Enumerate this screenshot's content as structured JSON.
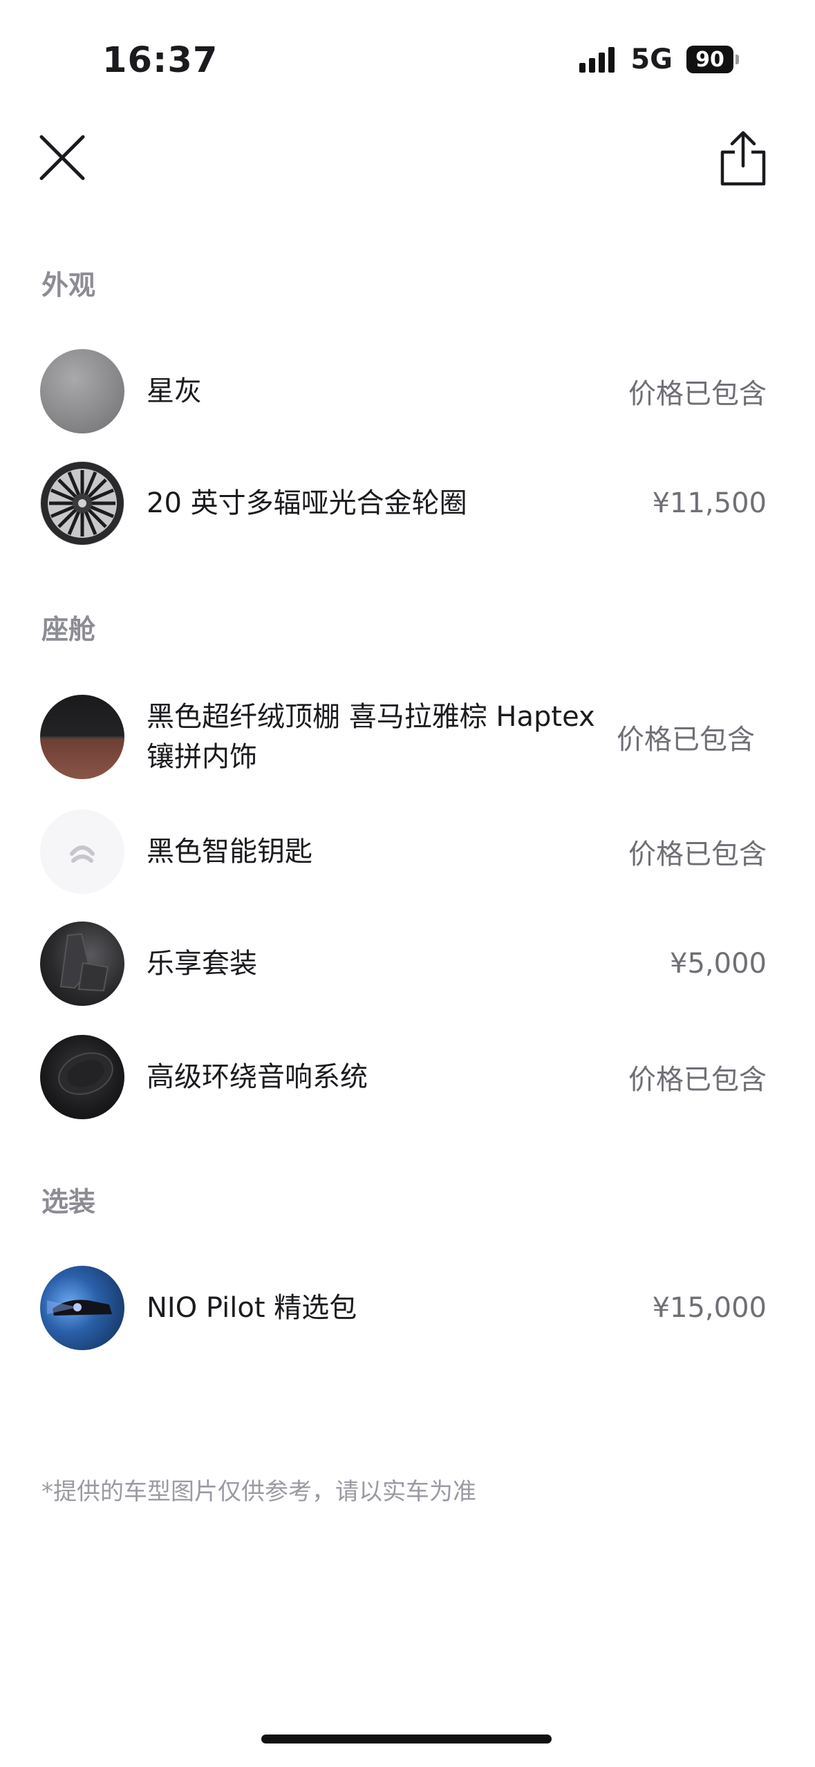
{
  "status_bar": {
    "time": "16:37",
    "network": "5G",
    "battery": "90"
  },
  "sections": [
    {
      "title": "外观",
      "items": [
        {
          "name": "星灰",
          "price": "价格已包含",
          "icon": "grey-paint-swatch"
        },
        {
          "name": "20 英寸多辐哑光合金轮圈",
          "price": "¥11,500",
          "icon": "alloy-wheel"
        }
      ]
    },
    {
      "title": "座舱",
      "items": [
        {
          "name": "黑色超纤绒顶棚 喜马拉雅棕 Haptex 镶拼内饰",
          "price": "价格已包含",
          "icon": "interior-swatch"
        },
        {
          "name": "黑色智能钥匙",
          "price": "价格已包含",
          "icon": "smart-key"
        },
        {
          "name": "乐享套装",
          "price": "¥5,000",
          "icon": "seat"
        },
        {
          "name": "高级环绕音响系统",
          "price": "价格已包含",
          "icon": "speaker"
        }
      ]
    },
    {
      "title": "选装",
      "items": [
        {
          "name": "NIO Pilot 精选包",
          "price": "¥15,000",
          "icon": "nio-pilot"
        }
      ]
    }
  ],
  "footer_note": "*提供的车型图片仅供参考，请以实车为准"
}
